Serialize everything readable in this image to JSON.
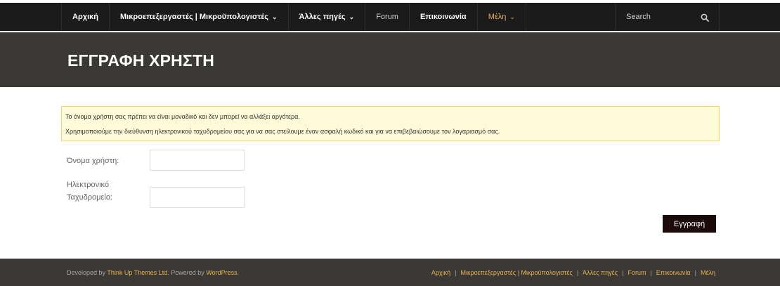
{
  "nav": {
    "items": [
      {
        "label": "Αρχική",
        "style": "bold",
        "dropdown": false
      },
      {
        "label": "Μικροεπεξεργαστές | Μικροϋπολογιστές",
        "style": "bold",
        "dropdown": true
      },
      {
        "label": "Άλλες πηγές",
        "style": "bold",
        "dropdown": true
      },
      {
        "label": "Forum",
        "style": "light",
        "dropdown": false
      },
      {
        "label": "Επικοινωνία",
        "style": "bold",
        "dropdown": false
      },
      {
        "label": "Μέλη",
        "style": "accent",
        "dropdown": true
      }
    ],
    "search_placeholder": "Search"
  },
  "header": {
    "title": "ΕΓΓΡΑΦΗ ΧΡΗΣΤΗ"
  },
  "notice": {
    "line1": "Το όνομα χρήστη σας πρέπει να είναι μοναδικό και δεν μπορεί να αλλάξει αργότερα.",
    "line2": "Χρησιμοποιούμε την διεύθυνση ηλεκτρονικού ταχυδρομείου σας για να σας στείλουμε έναν ασφαλή κωδικό και για να επιβεβαιώσουμε τον λογαριασμό σας."
  },
  "form": {
    "username_label": "Όνομα χρήστη:",
    "username_value": "",
    "email_label_line1": "Ηλεκτρονικό",
    "email_label_line2": "Ταχυδρομείο:",
    "email_value": "",
    "submit_label": "Εγγραφή"
  },
  "footer": {
    "developed_by": "Developed by",
    "theme_link": "Think Up Themes Ltd",
    "powered_by": ". Powered by",
    "wp_link": "WordPress",
    "end": ".",
    "links": [
      "Αρχική",
      "Μικροεπεξεργαστές | Μικροϋπολογιστές",
      "Άλλες πηγές",
      "Forum",
      "Επικοινωνία",
      "Μέλη"
    ],
    "separator": "|"
  },
  "colors": {
    "nav_bg": "#1b1b1b",
    "band_bg": "#3b3935",
    "accent": "#e8b14a",
    "notice_bg": "#fffbd8",
    "notice_border": "#f0d96a",
    "button_bg": "#1b0a0a"
  },
  "icons": {
    "search": "search-icon",
    "dropdown": "chevron-down-icon"
  }
}
